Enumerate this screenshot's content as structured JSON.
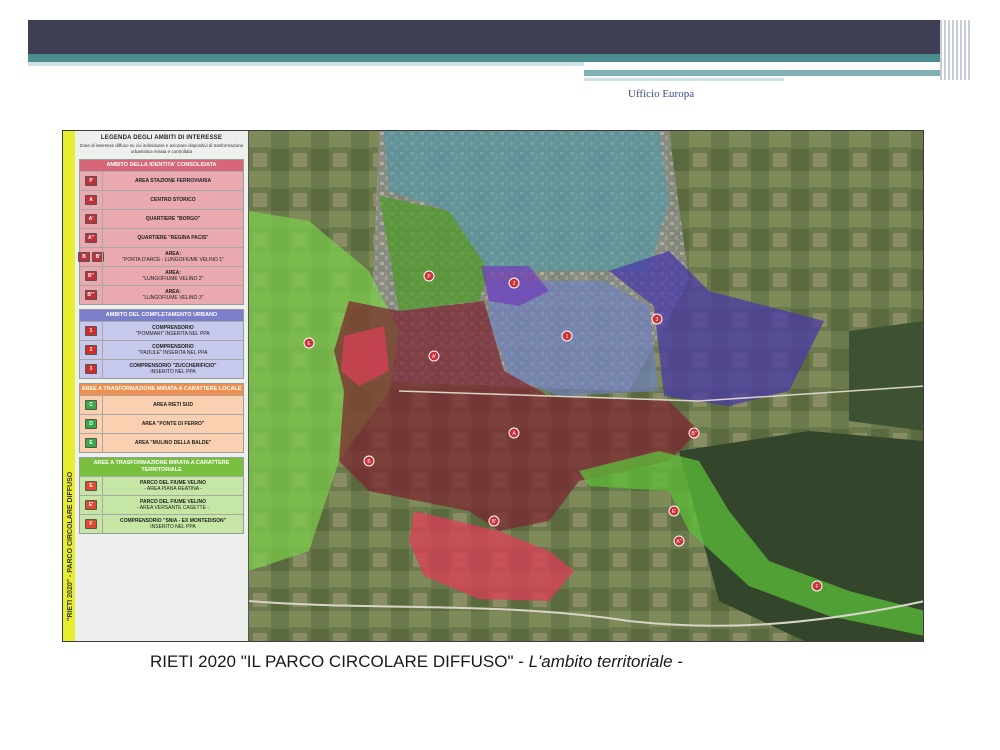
{
  "header": {
    "office_label": "Ufficio Europa"
  },
  "strip": {
    "text": "\"RIETI 2020\" - PARCO CIRCOLARE DIFFUSO"
  },
  "legend": {
    "title": "LEGENDA DEGLI AMBITI DI INTERESSE",
    "subtitle": "Zone di interesse diffuso su cui individuare e azionare dispositivi di trasformazione urbanistica mirata e controllata",
    "sections": [
      {
        "heading": "AMBITO DELLA IDENTITA' CONSOLIDATA",
        "color": "#d76776",
        "items": [
          {
            "codes": [
              "P"
            ],
            "label": "AREA STAZIONE FERROVIARIA",
            "label2": ""
          },
          {
            "codes": [
              "A"
            ],
            "label": "CENTRO STORICO",
            "label2": ""
          },
          {
            "codes": [
              "A'"
            ],
            "label": "QUARTIERE \"BORGO\"",
            "label2": ""
          },
          {
            "codes": [
              "A''"
            ],
            "label": "QUARTIERE \"REGINA PACIS\"",
            "label2": ""
          },
          {
            "codes": [
              "B",
              "B'"
            ],
            "label": "AREA:",
            "label2": "\"PORTA D'ARCE - LUNGOFIUME VELINO 1\""
          },
          {
            "codes": [
              "B''"
            ],
            "label": "AREA:",
            "label2": "\"LUNGOFIUME VELINO 2\""
          },
          {
            "codes": [
              "B'''"
            ],
            "label": "AREA:",
            "label2": "\"LUNGOFIUME VELINO 3\""
          }
        ]
      },
      {
        "heading": "AMBITO DEL COMPLETAMENTO URBANO",
        "color": "#7b7ec9",
        "items": [
          {
            "codes": [
              "1"
            ],
            "label": "COMPRENSORIO",
            "label2": "\"POMMARI\" INSERITA NEL PPA"
          },
          {
            "codes": [
              "2"
            ],
            "label": "COMPRENSORIO",
            "label2": "\"PADULE\" INSERITA NEL PPA"
          },
          {
            "codes": [
              "3"
            ],
            "label": "COMPRENSORIO \"ZUCCHERIFICIO\"",
            "label2": "INSERITO NEL PPA"
          }
        ]
      },
      {
        "heading": "AREE A TRASFORMAZIONE MIRATA A CARATTERE LOCALE",
        "color": "#f0904e",
        "items": [
          {
            "codes": [
              "C"
            ],
            "label": "AREA RIETI SUD",
            "label2": ""
          },
          {
            "codes": [
              "D"
            ],
            "label": "AREA \"PONTE DI FERRO\"",
            "label2": ""
          },
          {
            "codes": [
              "E"
            ],
            "label": "AREA \"MULINO DELLA BALDE\"",
            "label2": ""
          }
        ]
      },
      {
        "heading": "AREE A TRASFORMAZIONE MIRATA A CARATTERE TERRITORIALE",
        "color": "#78bf3f",
        "items": [
          {
            "codes": [
              "E"
            ],
            "label": "PARCO DEL FIUME VELINO",
            "label2": "- AREA PIANA REATINA -"
          },
          {
            "codes": [
              "E'"
            ],
            "label": "PARCO DEL FIUME VELINO",
            "label2": "- AREA VERSANTE CASETTE -"
          },
          {
            "codes": [
              "F"
            ],
            "label": "COMPRENSORIO \"SNIA - EX MONTEDISON\"",
            "label2": "INSERITO NEL PPA"
          }
        ]
      }
    ]
  },
  "map": {
    "markers": [
      {
        "code": "P"
      },
      {
        "code": "A"
      },
      {
        "code": "A'"
      },
      {
        "code": "A''"
      },
      {
        "code": "B"
      },
      {
        "code": "B'"
      },
      {
        "code": "B''"
      },
      {
        "code": "1"
      },
      {
        "code": "2"
      },
      {
        "code": "3"
      },
      {
        "code": "E"
      },
      {
        "code": "E'"
      },
      {
        "code": "F"
      }
    ]
  },
  "caption": {
    "main": "RIETI 2020 \"IL PARCO CIRCOLARE DIFFUSO\" - ",
    "italic": "L'ambito territoriale",
    "tail": " -"
  }
}
